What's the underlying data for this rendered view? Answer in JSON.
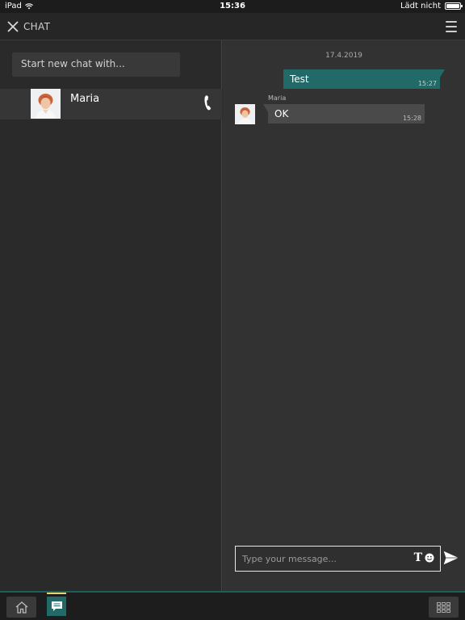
{
  "status_bar": {
    "device": "iPad",
    "time": "15:36",
    "battery_text": "Lädt nicht",
    "wifi_icon": "wifi-icon",
    "battery_icon": "battery-icon"
  },
  "header": {
    "title": "CHAT",
    "close_icon": "close-icon",
    "menu_icon": "hamburger-menu-icon"
  },
  "sidebar": {
    "new_chat_placeholder": "Start new chat with...",
    "contacts": [
      {
        "name": "Maria",
        "avatar_icon": "avatar",
        "action_icon": "phone-icon"
      }
    ]
  },
  "conversation": {
    "date": "17.4.2019",
    "messages": [
      {
        "direction": "outgoing",
        "text": "Test",
        "time": "15:27"
      },
      {
        "direction": "incoming",
        "sender": "Maria",
        "text": "OK",
        "time": "15:28"
      }
    ],
    "input_placeholder": "Type your message...",
    "format_label": "T",
    "emoji_icon": "emoji-icon",
    "send_icon": "send-icon"
  },
  "bottom_bar": {
    "home_icon": "home-icon",
    "chat_icon": "chat-icon",
    "apps_icon": "grid-icon"
  },
  "colors": {
    "accent": "#216a67",
    "active_indicator": "#e8d36a",
    "background": "#2e2e2e"
  }
}
